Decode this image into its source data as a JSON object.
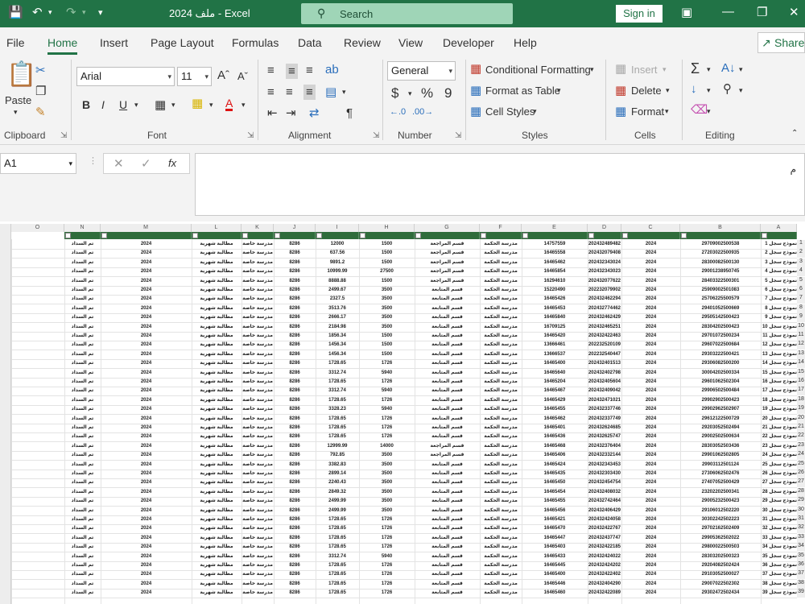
{
  "titlebar": {
    "title": "ملف 2024 - Excel",
    "search_placeholder": "Search",
    "signin": "Sign in"
  },
  "tabs": [
    "File",
    "Home",
    "Insert",
    "Page Layout",
    "Formulas",
    "Data",
    "Review",
    "View",
    "Developer",
    "Help"
  ],
  "share": "Share",
  "ribbon": {
    "clipboard": {
      "paste": "Paste",
      "label": "Clipboard"
    },
    "font": {
      "name": "Arial",
      "size": "11",
      "bold": "B",
      "italic": "I",
      "underline": "U",
      "label": "Font"
    },
    "alignment": {
      "label": "Alignment"
    },
    "number": {
      "format": "General",
      "currency": "$",
      "percent": "%",
      "comma": "9",
      "label": "Number"
    },
    "styles": {
      "cond": "Conditional Formatting",
      "table": "Format as Table",
      "cell": "Cell Styles",
      "label": "Styles"
    },
    "cells": {
      "insert": "Insert",
      "delete": "Delete",
      "format": "Format",
      "label": "Cells"
    },
    "editing": {
      "label": "Editing"
    }
  },
  "formula": {
    "namebox": "A1",
    "fx": "fx",
    "content": "م"
  },
  "columns": [
    "O",
    "N",
    "M",
    "L",
    "K",
    "J",
    "I",
    "H",
    "G",
    "F",
    "E",
    "D",
    "C",
    "B",
    "A"
  ],
  "rows": [
    [
      "",
      "تم السداد",
      "2024",
      "مطالبة شهرية",
      "مدرسة خاصة",
      "8286",
      "12000",
      "1500",
      "قسم المراجعة",
      "مدرسة الحكمة",
      "14757559",
      "202432489482",
      "2024",
      "29709002500538",
      "نموذج سجل 1",
      "1"
    ],
    [
      "",
      "تم السداد",
      "2024",
      "مطالبة شهرية",
      "مدرسة خاصة",
      "8286",
      "637.56",
      "1500",
      "قسم المراجعة",
      "مدرسة الحكمة",
      "16465558",
      "202432079408",
      "2024",
      "27203022500935",
      "نموذج سجل 2",
      "2"
    ],
    [
      "",
      "تم السداد",
      "2024",
      "مطالبة شهرية",
      "مدرسة خاصة",
      "8286",
      "9891.2",
      "1500",
      "قسم المراجعة",
      "مدرسة الحكمة",
      "16465462",
      "202432343024",
      "2024",
      "28300082500130",
      "نموذج سجل 3",
      "3"
    ],
    [
      "",
      "تم السداد",
      "2024",
      "مطالبة شهرية",
      "مدرسة خاصة",
      "8286",
      "10999.99",
      "27500",
      "قسم المراجعة",
      "مدرسة الحكمة",
      "16465854",
      "202432343023",
      "2024",
      "29001238950745",
      "نموذج سجل 4",
      "4"
    ],
    [
      "",
      "تم السداد",
      "2024",
      "مطالبة شهرية",
      "مدرسة خاصة",
      "8286",
      "8888.88",
      "1500",
      "قسم المراجعة",
      "مدرسة الحكمة",
      "16294610",
      "202432077622",
      "2024",
      "28403322500301",
      "نموذج سجل 5",
      "5"
    ],
    [
      "",
      "تم السداد",
      "2024",
      "مطالبة شهرية",
      "مدرسة خاصة",
      "8286",
      "2499.67",
      "3500",
      "قسم المتابعة",
      "مدرسة الحكمة",
      "15220490",
      "202232079902",
      "2024",
      "25909002501083",
      "نموذج سجل 6",
      "6"
    ],
    [
      "",
      "تم السداد",
      "2024",
      "مطالبة شهرية",
      "مدرسة خاصة",
      "8286",
      "2327.5",
      "3500",
      "قسم المتابعة",
      "مدرسة الحكمة",
      "16465426",
      "202432462294",
      "2024",
      "25706225500579",
      "نموذج سجل 7",
      "7"
    ],
    [
      "",
      "تم السداد",
      "2024",
      "مطالبة شهرية",
      "مدرسة خاصة",
      "8286",
      "3513.76",
      "3500",
      "قسم المتابعة",
      "مدرسة الحكمة",
      "16465453",
      "202432774462",
      "2024",
      "29401052500669",
      "نموذج سجل 8",
      "8"
    ],
    [
      "",
      "تم السداد",
      "2024",
      "مطالبة شهرية",
      "مدرسة خاصة",
      "8286",
      "2666.17",
      "3500",
      "قسم المتابعة",
      "مدرسة الحكمة",
      "16465840",
      "202432462429",
      "2024",
      "29505142500423",
      "نموذج سجل 9",
      "9"
    ],
    [
      "",
      "تم السداد",
      "2024",
      "مطالبة شهرية",
      "مدرسة خاصة",
      "8286",
      "2184.98",
      "3500",
      "قسم المتابعة",
      "مدرسة الحكمة",
      "16709125",
      "202432465251",
      "2024",
      "28304202500423",
      "نموذج سجل 10",
      "10"
    ],
    [
      "",
      "تم السداد",
      "2024",
      "مطالبة شهرية",
      "مدرسة خاصة",
      "8286",
      "1856.34",
      "1500",
      "قسم المتابعة",
      "مدرسة الحكمة",
      "16465420",
      "202432422463",
      "2024",
      "29701072500234",
      "نموذج سجل 11",
      "11"
    ],
    [
      "",
      "تم السداد",
      "2024",
      "مطالبة شهرية",
      "مدرسة خاصة",
      "8286",
      "1456.34",
      "1500",
      "قسم المتابعة",
      "مدرسة الحكمة",
      "13666461",
      "202232520109",
      "2024",
      "29607022500684",
      "نموذج سجل 12",
      "12"
    ],
    [
      "",
      "تم السداد",
      "2024",
      "مطالبة شهرية",
      "مدرسة خاصة",
      "8286",
      "1456.34",
      "1500",
      "قسم المتابعة",
      "مدرسة الحكمة",
      "13666537",
      "202232540447",
      "2024",
      "29303222500421",
      "نموذج سجل 13",
      "13"
    ],
    [
      "",
      "تم السداد",
      "2024",
      "مطالبة شهرية",
      "مدرسة خاصة",
      "8286",
      "1728.65",
      "1726",
      "قسم المتابعة",
      "مدرسة الحكمة",
      "16465400",
      "202432401513",
      "2024",
      "29306082500200",
      "نموذج سجل 14",
      "14"
    ],
    [
      "",
      "تم السداد",
      "2024",
      "مطالبة شهرية",
      "مدرسة خاصة",
      "8286",
      "3312.74",
      "5940",
      "قسم المتابعة",
      "مدرسة الحكمة",
      "16465640",
      "202432402798",
      "2024",
      "30004202500334",
      "نموذج سجل 15",
      "15"
    ],
    [
      "",
      "تم السداد",
      "2024",
      "مطالبة شهرية",
      "مدرسة خاصة",
      "8286",
      "1728.65",
      "1726",
      "قسم المتابعة",
      "مدرسة الحكمة",
      "16465204",
      "202432405604",
      "2024",
      "29601062502304",
      "نموذج سجل 16",
      "16"
    ],
    [
      "",
      "تم السداد",
      "2024",
      "مطالبة شهرية",
      "مدرسة خاصة",
      "8286",
      "3312.74",
      "5940",
      "قسم المتابعة",
      "مدرسة الحكمة",
      "16465467",
      "202432409042",
      "2024",
      "29906502500484",
      "نموذج سجل 17",
      "17"
    ],
    [
      "",
      "تم السداد",
      "2024",
      "مطالبة شهرية",
      "مدرسة خاصة",
      "8286",
      "1728.65",
      "1726",
      "قسم المتابعة",
      "مدرسة الحكمة",
      "16465429",
      "202432471021",
      "2024",
      "29902902500423",
      "نموذج سجل 18",
      "18"
    ],
    [
      "",
      "تم السداد",
      "2024",
      "مطالبة شهرية",
      "مدرسة خاصة",
      "8286",
      "3328.23",
      "5940",
      "قسم المتابعة",
      "مدرسة الحكمة",
      "16465455",
      "202432337746",
      "2024",
      "29902962502907",
      "نموذج سجل 19",
      "19"
    ],
    [
      "",
      "تم السداد",
      "2024",
      "مطالبة شهرية",
      "مدرسة خاصة",
      "8286",
      "1728.65",
      "1726",
      "قسم المتابعة",
      "مدرسة الحكمة",
      "16465462",
      "202432337749",
      "2024",
      "29612122500729",
      "نموذج سجل 20",
      "20"
    ],
    [
      "",
      "تم السداد",
      "2024",
      "مطالبة شهرية",
      "مدرسة خاصة",
      "8286",
      "1728.65",
      "1726",
      "قسم المتابعة",
      "مدرسة الحكمة",
      "16465401",
      "202432624685",
      "2024",
      "29203052502494",
      "نموذج سجل 21",
      "21"
    ],
    [
      "",
      "تم السداد",
      "2024",
      "مطالبة شهرية",
      "مدرسة خاصة",
      "8286",
      "1728.65",
      "1726",
      "قسم المتابعة",
      "مدرسة الحكمة",
      "16465436",
      "202432625747",
      "2024",
      "29002502500634",
      "نموذج سجل 22",
      "22"
    ],
    [
      "",
      "تم السداد",
      "2024",
      "مطالبة شهرية",
      "مدرسة خاصة",
      "8286",
      "12999.99",
      "14000",
      "قسم المراجعة",
      "مدرسة الحكمة",
      "16465468",
      "202432376404",
      "2024",
      "28303052503436",
      "نموذج سجل 23",
      "23"
    ],
    [
      "",
      "تم السداد",
      "2024",
      "مطالبة شهرية",
      "مدرسة خاصة",
      "8286",
      "792.85",
      "3500",
      "قسم المراجعة",
      "مدرسة الحكمة",
      "16465406",
      "202432332144",
      "2024",
      "29901062502805",
      "نموذج سجل 24",
      "24"
    ],
    [
      "",
      "تم السداد",
      "2024",
      "مطالبة شهرية",
      "مدرسة خاصة",
      "8286",
      "3382.83",
      "3500",
      "قسم المتابعة",
      "مدرسة الحكمة",
      "16465424",
      "202432343453",
      "2024",
      "29903112501124",
      "نموذج سجل 25",
      "25"
    ],
    [
      "",
      "تم السداد",
      "2024",
      "مطالبة شهرية",
      "مدرسة خاصة",
      "8286",
      "2899.14",
      "3500",
      "قسم المتابعة",
      "مدرسة الحكمة",
      "16465435",
      "202432303430",
      "2024",
      "27306062502476",
      "نموذج سجل 26",
      "26"
    ],
    [
      "",
      "تم السداد",
      "2024",
      "مطالبة شهرية",
      "مدرسة خاصة",
      "8286",
      "2240.43",
      "3500",
      "قسم المتابعة",
      "مدرسة الحكمة",
      "16465450",
      "202432454754",
      "2024",
      "27407052500429",
      "نموذج سجل 27",
      "27"
    ],
    [
      "",
      "تم السداد",
      "2024",
      "مطالبة شهرية",
      "مدرسة خاصة",
      "8286",
      "2849.32",
      "3500",
      "قسم المتابعة",
      "مدرسة الحكمة",
      "16465454",
      "202432408032",
      "2024",
      "23202202500341",
      "نموذج سجل 28",
      "28"
    ],
    [
      "",
      "تم السداد",
      "2024",
      "مطالبة شهرية",
      "مدرسة خاصة",
      "8286",
      "2499.99",
      "3500",
      "قسم المتابعة",
      "مدرسة الحكمة",
      "16465455",
      "202432742464",
      "2024",
      "29005232500423",
      "نموذج سجل 29",
      "29"
    ],
    [
      "",
      "تم السداد",
      "2024",
      "مطالبة شهرية",
      "مدرسة خاصة",
      "8286",
      "2499.99",
      "3500",
      "قسم المتابعة",
      "مدرسة الحكمة",
      "16465456",
      "202432406429",
      "2024",
      "29106012502220",
      "نموذج سجل 30",
      "30"
    ],
    [
      "",
      "تم السداد",
      "2024",
      "مطالبة شهرية",
      "مدرسة خاصة",
      "8286",
      "1728.65",
      "1726",
      "قسم المتابعة",
      "مدرسة الحكمة",
      "16465421",
      "202432424058",
      "2024",
      "30302242502223",
      "نموذج سجل 31",
      "31"
    ],
    [
      "",
      "تم السداد",
      "2024",
      "مطالبة شهرية",
      "مدرسة خاصة",
      "8286",
      "1728.65",
      "1726",
      "قسم المتابعة",
      "مدرسة الحكمة",
      "16465470",
      "202432422767",
      "2024",
      "29702162502409",
      "نموذج سجل 32",
      "32"
    ],
    [
      "",
      "تم السداد",
      "2024",
      "مطالبة شهرية",
      "مدرسة خاصة",
      "8286",
      "1728.65",
      "1726",
      "قسم المتابعة",
      "مدرسة الحكمة",
      "16465447",
      "202432437747",
      "2024",
      "29905362502022",
      "نموذج سجل 33",
      "33"
    ],
    [
      "",
      "تم السداد",
      "2024",
      "مطالبة شهرية",
      "مدرسة خاصة",
      "8286",
      "1728.65",
      "1726",
      "قسم المتابعة",
      "مدرسة الحكمة",
      "16465403",
      "202432422185",
      "2024",
      "29800022500503",
      "نموذج سجل 34",
      "34"
    ],
    [
      "",
      "تم السداد",
      "2024",
      "مطالبة شهرية",
      "مدرسة خاصة",
      "8286",
      "3312.74",
      "5940",
      "قسم المتابعة",
      "مدرسة الحكمة",
      "16465433",
      "202432424022",
      "2024",
      "28303202500323",
      "نموذج سجل 35",
      "35"
    ],
    [
      "",
      "تم السداد",
      "2024",
      "مطالبة شهرية",
      "مدرسة خاصة",
      "8286",
      "1728.65",
      "1726",
      "قسم المتابعة",
      "مدرسة الحكمة",
      "16465445",
      "202432424202",
      "2024",
      "29204082502424",
      "نموذج سجل 36",
      "36"
    ],
    [
      "",
      "تم السداد",
      "2024",
      "مطالبة شهرية",
      "مدرسة خاصة",
      "8286",
      "1728.65",
      "1726",
      "قسم المتابعة",
      "مدرسة الحكمة",
      "16465400",
      "202432422402",
      "2024",
      "29103052500027",
      "نموذج سجل 37",
      "37"
    ],
    [
      "",
      "تم السداد",
      "2024",
      "مطالبة شهرية",
      "مدرسة خاصة",
      "8286",
      "1728.65",
      "1726",
      "قسم المتابعة",
      "مدرسة الحكمة",
      "16465446",
      "202432404290",
      "2024",
      "29007022502302",
      "نموذج سجل 38",
      "38"
    ],
    [
      "",
      "تم السداد",
      "2024",
      "مطالبة شهرية",
      "مدرسة خاصة",
      "8286",
      "1728.65",
      "1726",
      "قسم المتابعة",
      "مدرسة الحكمة",
      "16465460",
      "202432422089",
      "2024",
      "29302472502434",
      "نموذج سجل 39",
      "39"
    ]
  ]
}
